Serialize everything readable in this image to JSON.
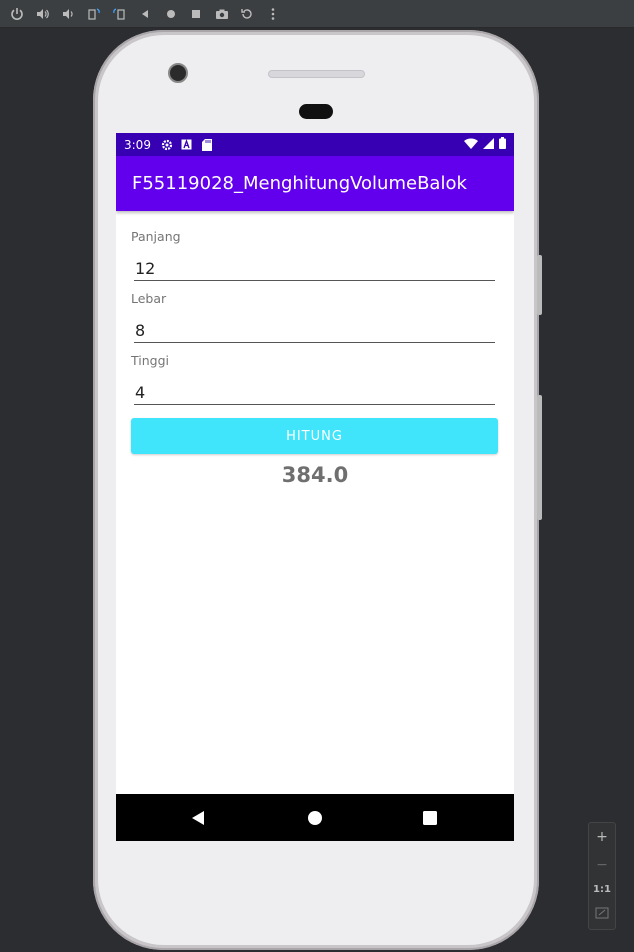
{
  "status_bar": {
    "time": "3:09"
  },
  "app_bar": {
    "title": "F55119028_MenghitungVolumeBalok"
  },
  "form": {
    "panjang": {
      "label": "Panjang",
      "value": "12"
    },
    "lebar": {
      "label": "Lebar",
      "value": "8"
    },
    "tinggi": {
      "label": "Tinggi",
      "value": "4"
    }
  },
  "button": {
    "label": "HITUNG"
  },
  "result": {
    "value": "384.0"
  },
  "zoom_panel": {
    "plus": "+",
    "minus": "−",
    "one_to_one": "1:1"
  },
  "colors": {
    "status_bar": "#3700b3",
    "app_bar": "#6200ee",
    "button": "#40e4fb",
    "result_text": "#6f6f6f"
  },
  "icons": {
    "toolbar": [
      "power-icon",
      "volume-up-icon",
      "volume-down-icon",
      "rotate-left-icon",
      "rotate-right-icon",
      "back-icon",
      "home-icon",
      "overview-icon",
      "camera-icon",
      "replay-icon",
      "more-icon"
    ],
    "status_left": [
      "settings-icon",
      "a-icon",
      "sd-card-icon"
    ],
    "status_right": [
      "wifi-icon",
      "signal-icon",
      "battery-icon"
    ],
    "nav": [
      "nav-back-icon",
      "nav-home-icon",
      "nav-recents-icon"
    ]
  }
}
